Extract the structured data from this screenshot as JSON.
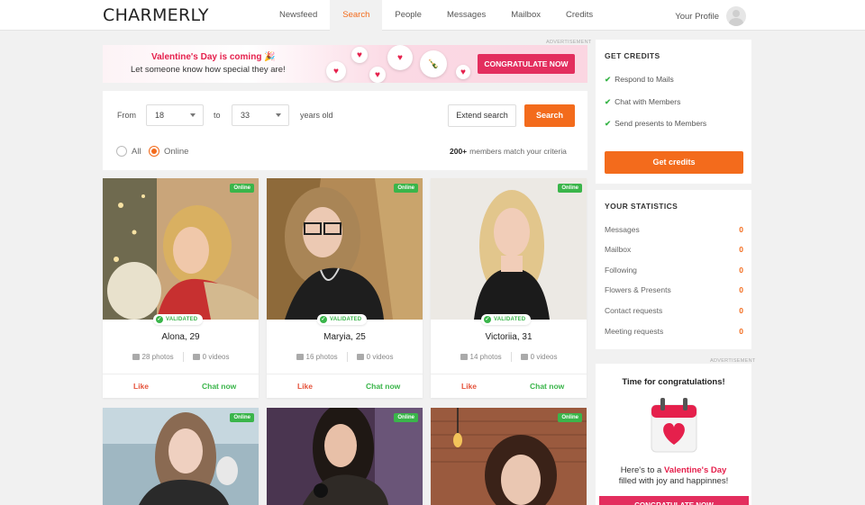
{
  "header": {
    "logo": "CHARMERLY",
    "nav": [
      "Newsfeed",
      "Search",
      "People",
      "Messages",
      "Mailbox",
      "Credits"
    ],
    "active_nav": "Search",
    "profile_label": "Your Profile"
  },
  "banner": {
    "ad_label": "ADVERTISEMENT",
    "title": "Valentine's Day is coming 🎉",
    "subtitle": "Let someone know how special they are!",
    "button": "CONGRATULATE NOW"
  },
  "filter": {
    "from_label": "From",
    "from_value": "18",
    "to_label": "to",
    "to_value": "33",
    "age_suffix": "years old",
    "extend_button": "Extend search",
    "search_button": "Search",
    "radio_all": "All",
    "radio_online": "Online",
    "selected_radio": "Online",
    "match_count": "200+",
    "match_text": "members match your criteria"
  },
  "profiles": [
    {
      "name": "Alona, 29",
      "status": "Online",
      "validated": "VALIDATED",
      "photos": "28 photos",
      "videos": "0 videos",
      "like": "Like",
      "chat": "Chat now"
    },
    {
      "name": "Maryia, 25",
      "status": "Online",
      "validated": "VALIDATED",
      "photos": "16 photos",
      "videos": "0 videos",
      "like": "Like",
      "chat": "Chat now"
    },
    {
      "name": "Victoriia, 31",
      "status": "Online",
      "validated": "VALIDATED",
      "photos": "14 photos",
      "videos": "0 videos",
      "like": "Like",
      "chat": "Chat now"
    },
    {
      "status": "Online"
    },
    {
      "status": "Online"
    },
    {
      "status": "Online"
    }
  ],
  "credits_panel": {
    "title": "GET CREDITS",
    "items": [
      "Respond to Mails",
      "Chat with Members",
      "Send presents to Members"
    ],
    "button": "Get credits"
  },
  "statistics_panel": {
    "title": "YOUR STATISTICS",
    "rows": [
      {
        "label": "Messages",
        "value": "0"
      },
      {
        "label": "Mailbox",
        "value": "0"
      },
      {
        "label": "Following",
        "value": "0"
      },
      {
        "label": "Flowers & Presents",
        "value": "0"
      },
      {
        "label": "Contact requests",
        "value": "0"
      },
      {
        "label": "Meeting requests",
        "value": "0"
      }
    ]
  },
  "promo": {
    "ad_label": "ADVERTISEMENT",
    "title": "Time for congratulations!",
    "text_pre": "Here's to a ",
    "text_highlight": "Valentine's Day",
    "text_post": " filled with joy and happinnes!",
    "button": "CONGRATULATE NOW"
  },
  "colors": {
    "accent": "#f36b1c",
    "valentine": "#e5204c",
    "online": "#3ab54a"
  }
}
